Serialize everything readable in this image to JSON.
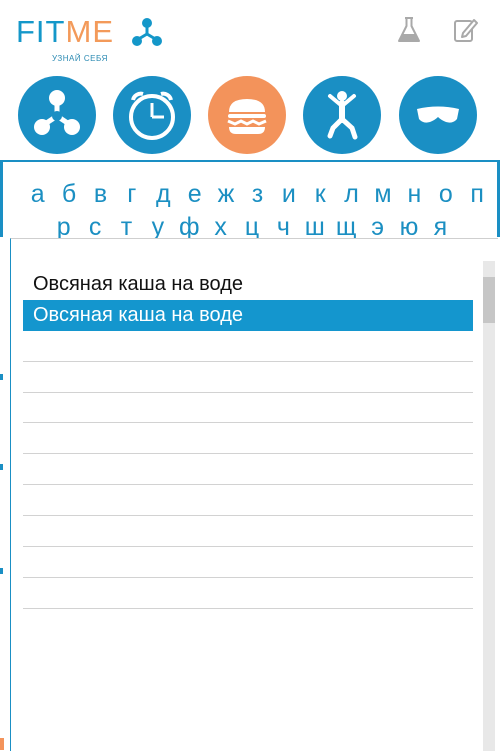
{
  "brand": {
    "fit": "FIT",
    "me": "ME",
    "tagline": "УЗНАЙ СЕБЯ"
  },
  "colors": {
    "accent_blue": "#1a8fc4",
    "accent_orange": "#f3935b",
    "selected_row": "#1496ce"
  },
  "header_actions": [
    {
      "icon": "flask-icon"
    },
    {
      "icon": "edit-icon"
    }
  ],
  "categories": [
    {
      "icon": "molecule-icon",
      "active": false
    },
    {
      "icon": "clock-icon",
      "active": false
    },
    {
      "icon": "burger-icon",
      "active": true
    },
    {
      "icon": "jumping-person-icon",
      "active": false
    },
    {
      "icon": "sleep-mask-icon",
      "active": false
    }
  ],
  "alphabet": {
    "row1": [
      "а",
      "б",
      "в",
      "г",
      "д",
      "е",
      "ж",
      "з",
      "и",
      "к",
      "л",
      "м",
      "н",
      "о",
      "п"
    ],
    "row2": [
      "р",
      "с",
      "т",
      "у",
      "ф",
      "х",
      "ц",
      "ч",
      "ш",
      "щ",
      "э",
      "ю",
      "я"
    ]
  },
  "food_list": {
    "items": [
      {
        "label": "Овсяная каша на воде",
        "state": "normal"
      },
      {
        "label": "Овсяная каша на воде",
        "state": "selected"
      },
      {
        "label": "",
        "state": "empty"
      },
      {
        "label": "",
        "state": "empty"
      },
      {
        "label": "",
        "state": "empty"
      },
      {
        "label": "",
        "state": "empty"
      },
      {
        "label": "",
        "state": "empty"
      },
      {
        "label": "",
        "state": "empty"
      },
      {
        "label": "",
        "state": "empty"
      },
      {
        "label": "",
        "state": "empty"
      },
      {
        "label": "",
        "state": "empty"
      }
    ]
  }
}
